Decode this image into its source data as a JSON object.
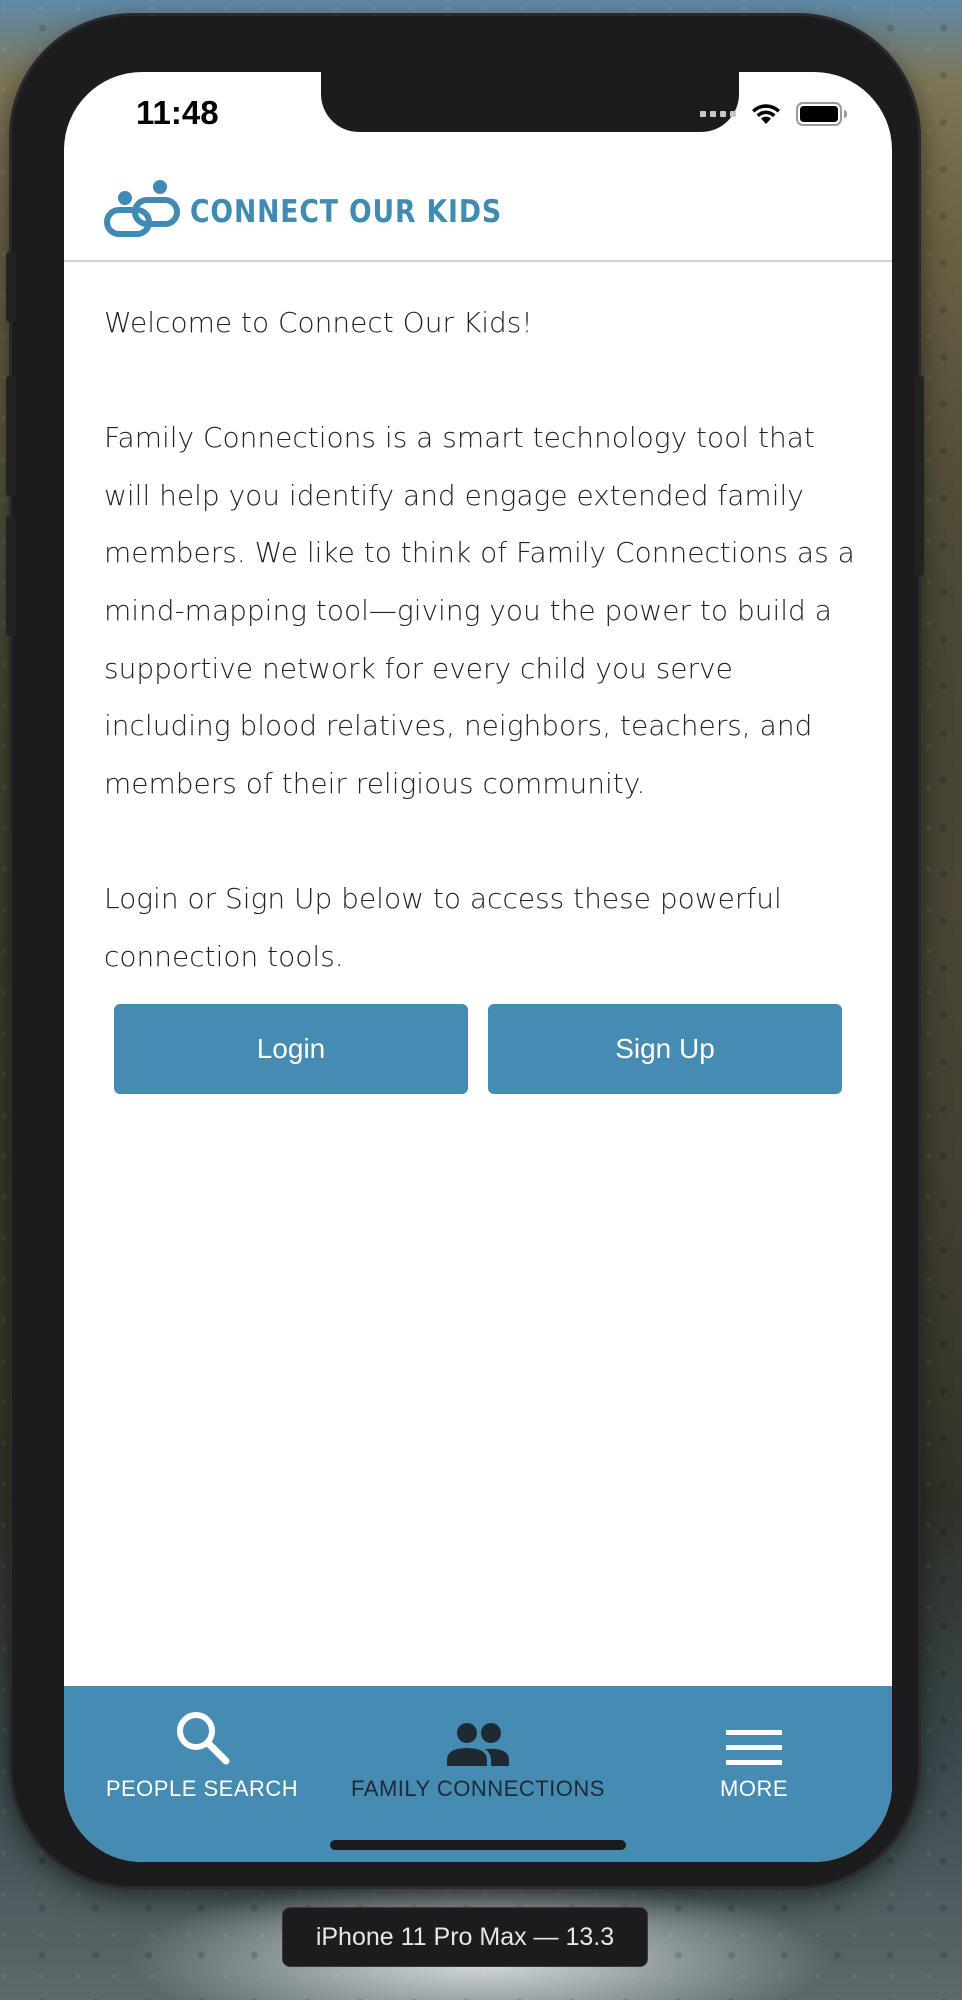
{
  "status_bar": {
    "time": "11:48"
  },
  "header": {
    "logo_text": "CONNECT OUR KIDS",
    "logo_icon": "connect-our-kids-logo-icon"
  },
  "content": {
    "welcome": "Welcome to Connect Our Kids!",
    "description": "Family Connections is a smart technology tool that will help you identify and engage extended family members. We like to think of Family Connections as a mind-mapping tool—giving you the power to build a supportive network for every child you serve including blood relatives, neighbors, teachers, and members of their religious community.",
    "prompt": "Login or Sign Up below to access these powerful connection tools."
  },
  "buttons": {
    "login": "Login",
    "signup": "Sign Up"
  },
  "tab_bar": {
    "tabs": [
      {
        "label": "PEOPLE SEARCH",
        "icon": "search-icon",
        "active": false
      },
      {
        "label": "FAMILY CONNECTIONS",
        "icon": "people-icon",
        "active": true
      },
      {
        "label": "MORE",
        "icon": "menu-icon",
        "active": false
      }
    ]
  },
  "simulator": {
    "device_label": "iPhone 11 Pro Max — 13.3"
  },
  "colors": {
    "brand": "#468bb2",
    "logo": "#3f8bb3",
    "active_tab_label": "#1e2a33"
  }
}
